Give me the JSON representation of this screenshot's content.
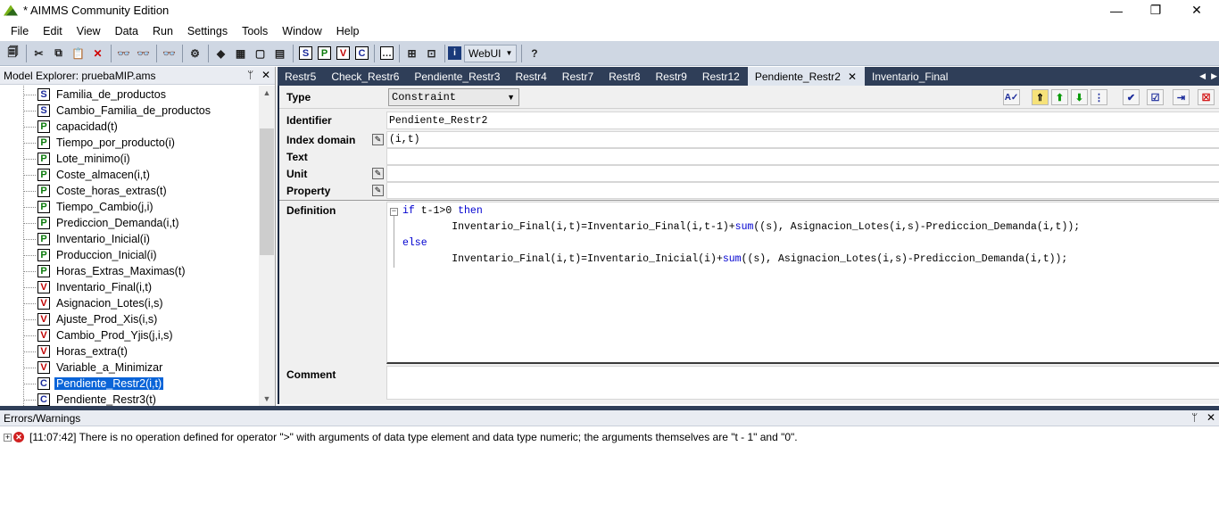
{
  "window": {
    "title": "* AIMMS Community Edition",
    "minimize": "—",
    "restore": "❐",
    "close": "✕"
  },
  "menu": [
    "File",
    "Edit",
    "View",
    "Data",
    "Run",
    "Settings",
    "Tools",
    "Window",
    "Help"
  ],
  "toolbar": {
    "icons": [
      "save-all",
      "cut",
      "copy",
      "paste",
      "delete",
      "find",
      "find-next",
      "find-prev",
      "properties",
      "model",
      "data-page",
      "page",
      "page-f",
      "S",
      "P",
      "V",
      "C",
      "ellipsis",
      "identifier-view",
      "compile",
      "info",
      "WebUI",
      "help"
    ],
    "webui_label": "WebUI",
    "S": "S",
    "P": "P",
    "V": "V",
    "C": "C",
    "ellipsis": "…"
  },
  "explorer": {
    "title": "Model Explorer: pruebaMIP.ams",
    "pin": "📌",
    "close": "✕",
    "items": [
      {
        "type": "S",
        "label": "Familia_de_productos"
      },
      {
        "type": "S",
        "label": "Cambio_Familia_de_productos"
      },
      {
        "type": "P",
        "label": "capacidad(t)"
      },
      {
        "type": "P",
        "label": "Tiempo_por_producto(i)"
      },
      {
        "type": "P",
        "label": "Lote_minimo(i)"
      },
      {
        "type": "P",
        "label": "Coste_almacen(i,t)"
      },
      {
        "type": "P",
        "label": "Coste_horas_extras(t)"
      },
      {
        "type": "P",
        "label": "Tiempo_Cambio(j,i)"
      },
      {
        "type": "P",
        "label": "Prediccion_Demanda(i,t)"
      },
      {
        "type": "P",
        "label": "Inventario_Inicial(i)"
      },
      {
        "type": "P",
        "label": "Produccion_Inicial(i)"
      },
      {
        "type": "P",
        "label": "Horas_Extras_Maximas(t)"
      },
      {
        "type": "V",
        "label": "Inventario_Final(i,t)"
      },
      {
        "type": "V",
        "label": "Asignacion_Lotes(i,s)"
      },
      {
        "type": "V",
        "label": "Ajuste_Prod_Xis(i,s)"
      },
      {
        "type": "V",
        "label": "Cambio_Prod_Yjis(j,i,s)"
      },
      {
        "type": "V",
        "label": "Horas_extra(t)"
      },
      {
        "type": "V",
        "label": "Variable_a_Minimizar"
      },
      {
        "type": "C",
        "label": "Pendiente_Restr2(i,t)",
        "selected": true
      },
      {
        "type": "C",
        "label": "Pendiente_Restr3(t)"
      }
    ]
  },
  "tabs": [
    {
      "label": "Restr5"
    },
    {
      "label": "Check_Restr6"
    },
    {
      "label": "Pendiente_Restr3"
    },
    {
      "label": "Restr4"
    },
    {
      "label": "Restr7"
    },
    {
      "label": "Restr8"
    },
    {
      "label": "Restr9"
    },
    {
      "label": "Restr12"
    },
    {
      "label": "Pendiente_Restr2",
      "active": true,
      "close": "✕"
    },
    {
      "label": "Inventario_Final"
    }
  ],
  "tab_nav": {
    "left": "◀",
    "right": "▶"
  },
  "editor": {
    "type_label": "Type",
    "type_value": "Constraint",
    "identifier_label": "Identifier",
    "identifier_value": "Pendiente_Restr2",
    "index_domain_label": "Index domain",
    "index_domain_value": "(i,t)",
    "text_label": "Text",
    "text_value": "",
    "unit_label": "Unit",
    "unit_value": "",
    "property_label": "Property",
    "property_value": "",
    "definition_label": "Definition",
    "definition_lines": [
      {
        "kw1": "if",
        "text": " t-1>0 ",
        "kw2": "then"
      },
      {
        "pre": "        Inventario_Final(i,t)=Inventario_Final(i,t-1)+",
        "kw": "sum",
        "post": "((s), Asignacion_Lotes(i,s)-Prediccion_Demanda(i,t));"
      },
      {
        "kw1": "else"
      },
      {
        "pre": "        Inventario_Final(i,t)=Inventario_Inicial(i)+",
        "kw": "sum",
        "post": "((s), Asignacion_Lotes(i,s)-Prediccion_Demanda(i,t));"
      }
    ],
    "comment_label": "Comment",
    "comment_value": "",
    "right_buttons": [
      "spell-check",
      "up",
      "up-green",
      "down-green",
      "tree",
      "check",
      "check-all",
      "export",
      "cancel"
    ]
  },
  "errors": {
    "title": "Errors/Warnings",
    "pin": "📌",
    "close": "✕",
    "message": "[11:07:42]  There is no operation defined for operator \">\" with arguments of data type element and data type numeric; the arguments themselves are \"t - 1\" and \"0\"."
  },
  "colors": {
    "accent": "#0a64d8",
    "tabbar": "#2f3e58",
    "toolbar": "#cfd7e3",
    "keyword": "#0000d0"
  }
}
